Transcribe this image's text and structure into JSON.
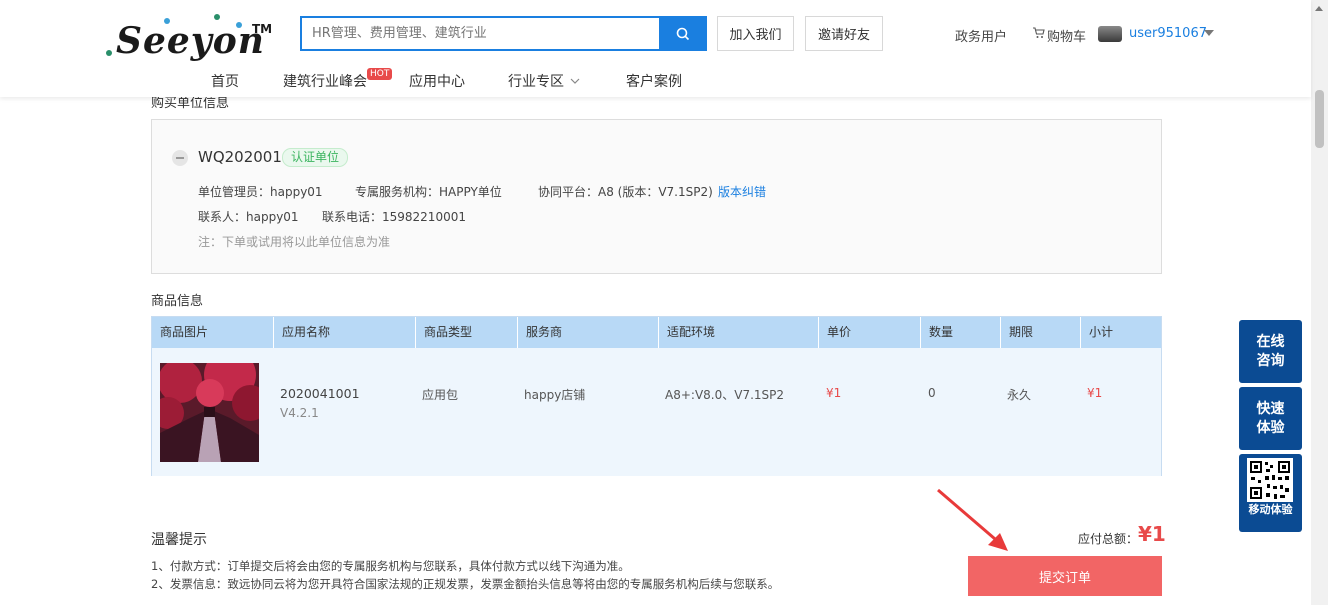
{
  "header": {
    "logo_text": "Seeyon",
    "logo_tm": "TM",
    "search_placeholder": "HR管理、费用管理、建筑行业",
    "join_label": "加入我们",
    "invite_label": "邀请好友",
    "gov_user_label": "政务用户",
    "cart_label": "购物车",
    "username": "user951067"
  },
  "nav": {
    "items": [
      "首页",
      "建筑行业峰会",
      "应用中心",
      "行业专区",
      "客户案例"
    ],
    "hot_badge": "HOT"
  },
  "buyer": {
    "section_title": "购买单位信息",
    "org_name": "WQ202001",
    "org_tag": "认证单位",
    "admin": "单位管理员：happy01",
    "service_org": "专属服务机构：HAPPY单位",
    "platform": "协同平台：A8 (版本：V7.1SP2)",
    "version_fix": "版本纠错",
    "contact": "联系人：happy01",
    "phone": "联系电话：15982210001",
    "note": "注：下单或试用将以此单位信息为准"
  },
  "product": {
    "section_title": "商品信息",
    "columns": [
      "商品图片",
      "应用名称",
      "商品类型",
      "服务商",
      "适配环境",
      "单价",
      "数量",
      "期限",
      "小计"
    ],
    "row": {
      "app_name": "2020041001",
      "app_version": "V4.2.1",
      "type": "应用包",
      "vendor": "happy店铺",
      "env": "A8+:V8.0、V7.1SP2",
      "unit_price": "¥1",
      "quantity": "0",
      "period": "永久",
      "subtotal": "¥1"
    }
  },
  "tips": {
    "title": "温馨提示",
    "line1": "1、付款方式：订单提交后将会由您的专属服务机构与您联系，具体付款方式以线下沟通为准。",
    "line2": "2、发票信息：致远协同云将为您开具符合国家法规的正规发票，发票金额抬头信息等将由您的专属服务机构后续与您联系。"
  },
  "order": {
    "total_label": "应付总额：",
    "total_value": "¥1",
    "submit_label": "提交订单"
  },
  "side": {
    "consult": "在线咨询",
    "trial": "快速体验",
    "mobile": "移动体验"
  },
  "colors": {
    "primary": "#1a7fe0",
    "accent_red": "#e84a4a",
    "submit": "#f26565",
    "side_bg": "#0b4b93",
    "table_header": "#b8d9f6"
  }
}
